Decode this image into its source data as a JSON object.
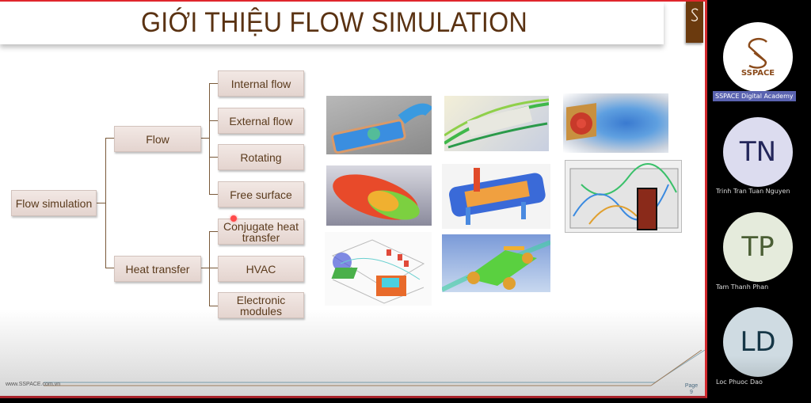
{
  "slide": {
    "title": "GIỚI THIỆU FLOW SIMULATION",
    "corner_logo_icon": "sspace-s-logo-icon",
    "footer_url": "www.SSPACE.com.vn",
    "page_label": "Page",
    "page_number": "9",
    "colors": {
      "title": "#5a3212",
      "border": "#d22a2e",
      "node_text": "#5a3a1c",
      "logo_bg": "#6b3a0e"
    },
    "tree": {
      "root": "Flow simulation",
      "branches": [
        {
          "label": "Flow",
          "children": [
            "Internal flow",
            "External flow",
            "Rotating",
            "Free surface"
          ]
        },
        {
          "label": "Heat transfer",
          "children": [
            "Conjugate heat transfer",
            "HVAC",
            "Electronic modules"
          ]
        }
      ]
    },
    "images": [
      "pipe-internal-flow-simulation",
      "external-flow-streamlines",
      "fan-rotating-flow",
      "tank-free-surface",
      "heat-exchanger-conjugate-heat",
      "room-hvac-streamlines",
      "electronics-enclosure-cooling",
      "race-car-external-flow"
    ]
  },
  "participants": {
    "host": {
      "initials": "SSPACE",
      "label": "SSPACE Digital Academy"
    },
    "list": [
      {
        "initials": "TN",
        "name": "Trinh Tran Tuan Nguyen",
        "bg": "#dcdcef",
        "fg": "#23265a"
      },
      {
        "initials": "TP",
        "name": "Tam Thanh Phan",
        "bg": "#e5ebdc",
        "fg": "#4a5e34"
      },
      {
        "initials": "LD",
        "name": "Loc Phuoc Dao",
        "bg": "#cfdbe2",
        "fg": "#163646"
      }
    ]
  }
}
